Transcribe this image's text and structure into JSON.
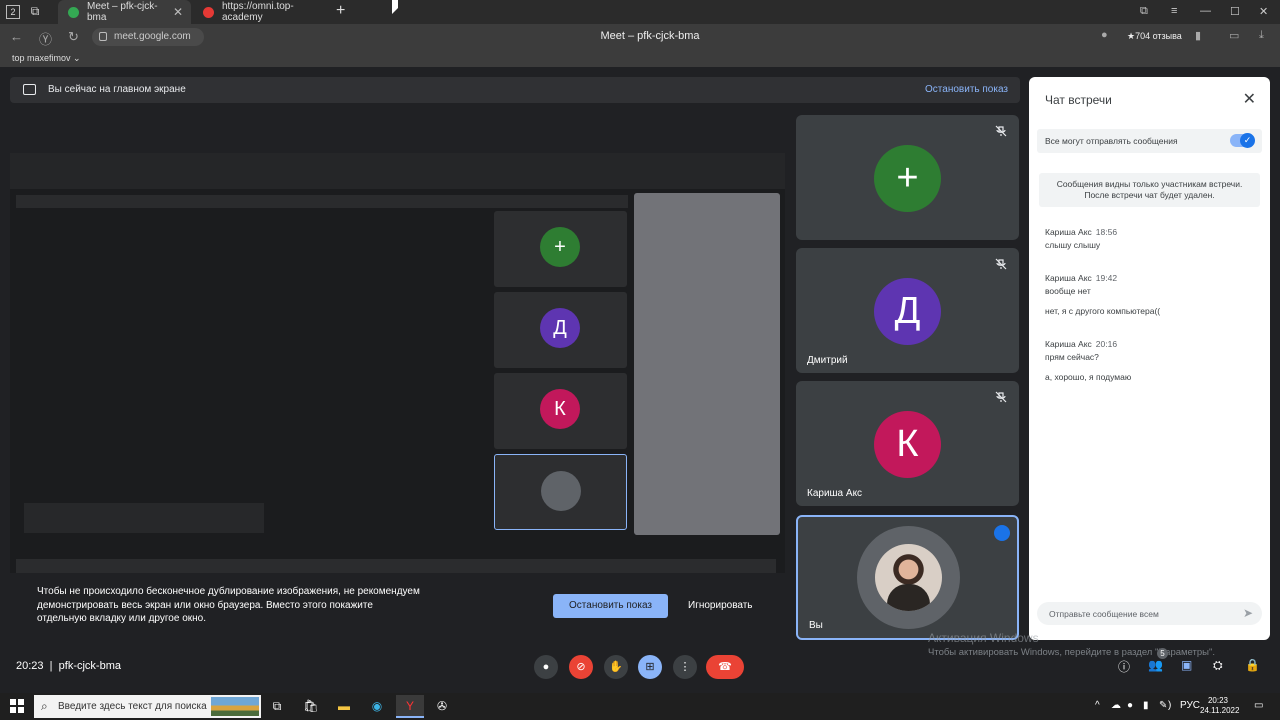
{
  "browser": {
    "tab_count": "2",
    "tabs": [
      {
        "label": "Meet – pfk-cjck-bma",
        "active": true
      },
      {
        "label": "https://omni.top-academy",
        "active": false
      }
    ],
    "url": "meet.google.com",
    "page_title": "Meet – pfk-cjck-bma",
    "rating": "★704 отзыва",
    "bookmark": "top maxefimov ⌄"
  },
  "banner": {
    "text": "Вы сейчас на главном экране",
    "stop_label": "Остановить показ"
  },
  "share_warning": {
    "lines": [
      "Чтобы не происходило бесконечное дублирование изображения, не рекомендуем",
      "демонстрировать весь экран или окно браузера. Вместо этого покажите",
      "отдельную вкладку или другое окно."
    ],
    "stop_button": "Остановить показ",
    "ignore_button": "Игнорировать"
  },
  "participants": [
    {
      "initial": "+",
      "name": "",
      "color": "#2e7d32",
      "muted": true
    },
    {
      "initial": "Д",
      "name": "Дмитрий",
      "color": "#5e35b1",
      "muted": true
    },
    {
      "initial": "К",
      "name": "Кариша Акс",
      "color": "#c2185b",
      "muted": true
    },
    {
      "initial": "",
      "name": "Вы",
      "color": "#5f6368",
      "speaking": true
    }
  ],
  "chat": {
    "title": "Чат встречи",
    "allow_label": "Все могут отправлять сообщения",
    "info": [
      "Сообщения видны только участникам встречи.",
      "После встречи чат будет удален."
    ],
    "messages": [
      {
        "author": "Кариша Акс",
        "time": "18:56",
        "lines": [
          "слышу слышу"
        ]
      },
      {
        "author": "Кариша Акс",
        "time": "19:42",
        "lines": [
          "вообще нет",
          "нет, я с другого компьютера(("
        ]
      },
      {
        "author": "Кариша Акс",
        "time": "20:16",
        "lines": [
          "прям сейчас?",
          "а, хорошо, я подумаю"
        ]
      }
    ],
    "input_placeholder": "Отправьте сообщение всем"
  },
  "activation": {
    "title": "Активация Windows",
    "subtitle": "Чтобы активировать Windows, перейдите в раздел \"Параметры\"."
  },
  "meeting": {
    "time": "20:23",
    "separator": "|",
    "code": "pfk-cjck-bma"
  },
  "taskbar": {
    "search_placeholder": "Введите здесь текст для поиска",
    "lang": "РУС",
    "time": "20:23",
    "date": "24.11.2022",
    "badge": "5"
  }
}
